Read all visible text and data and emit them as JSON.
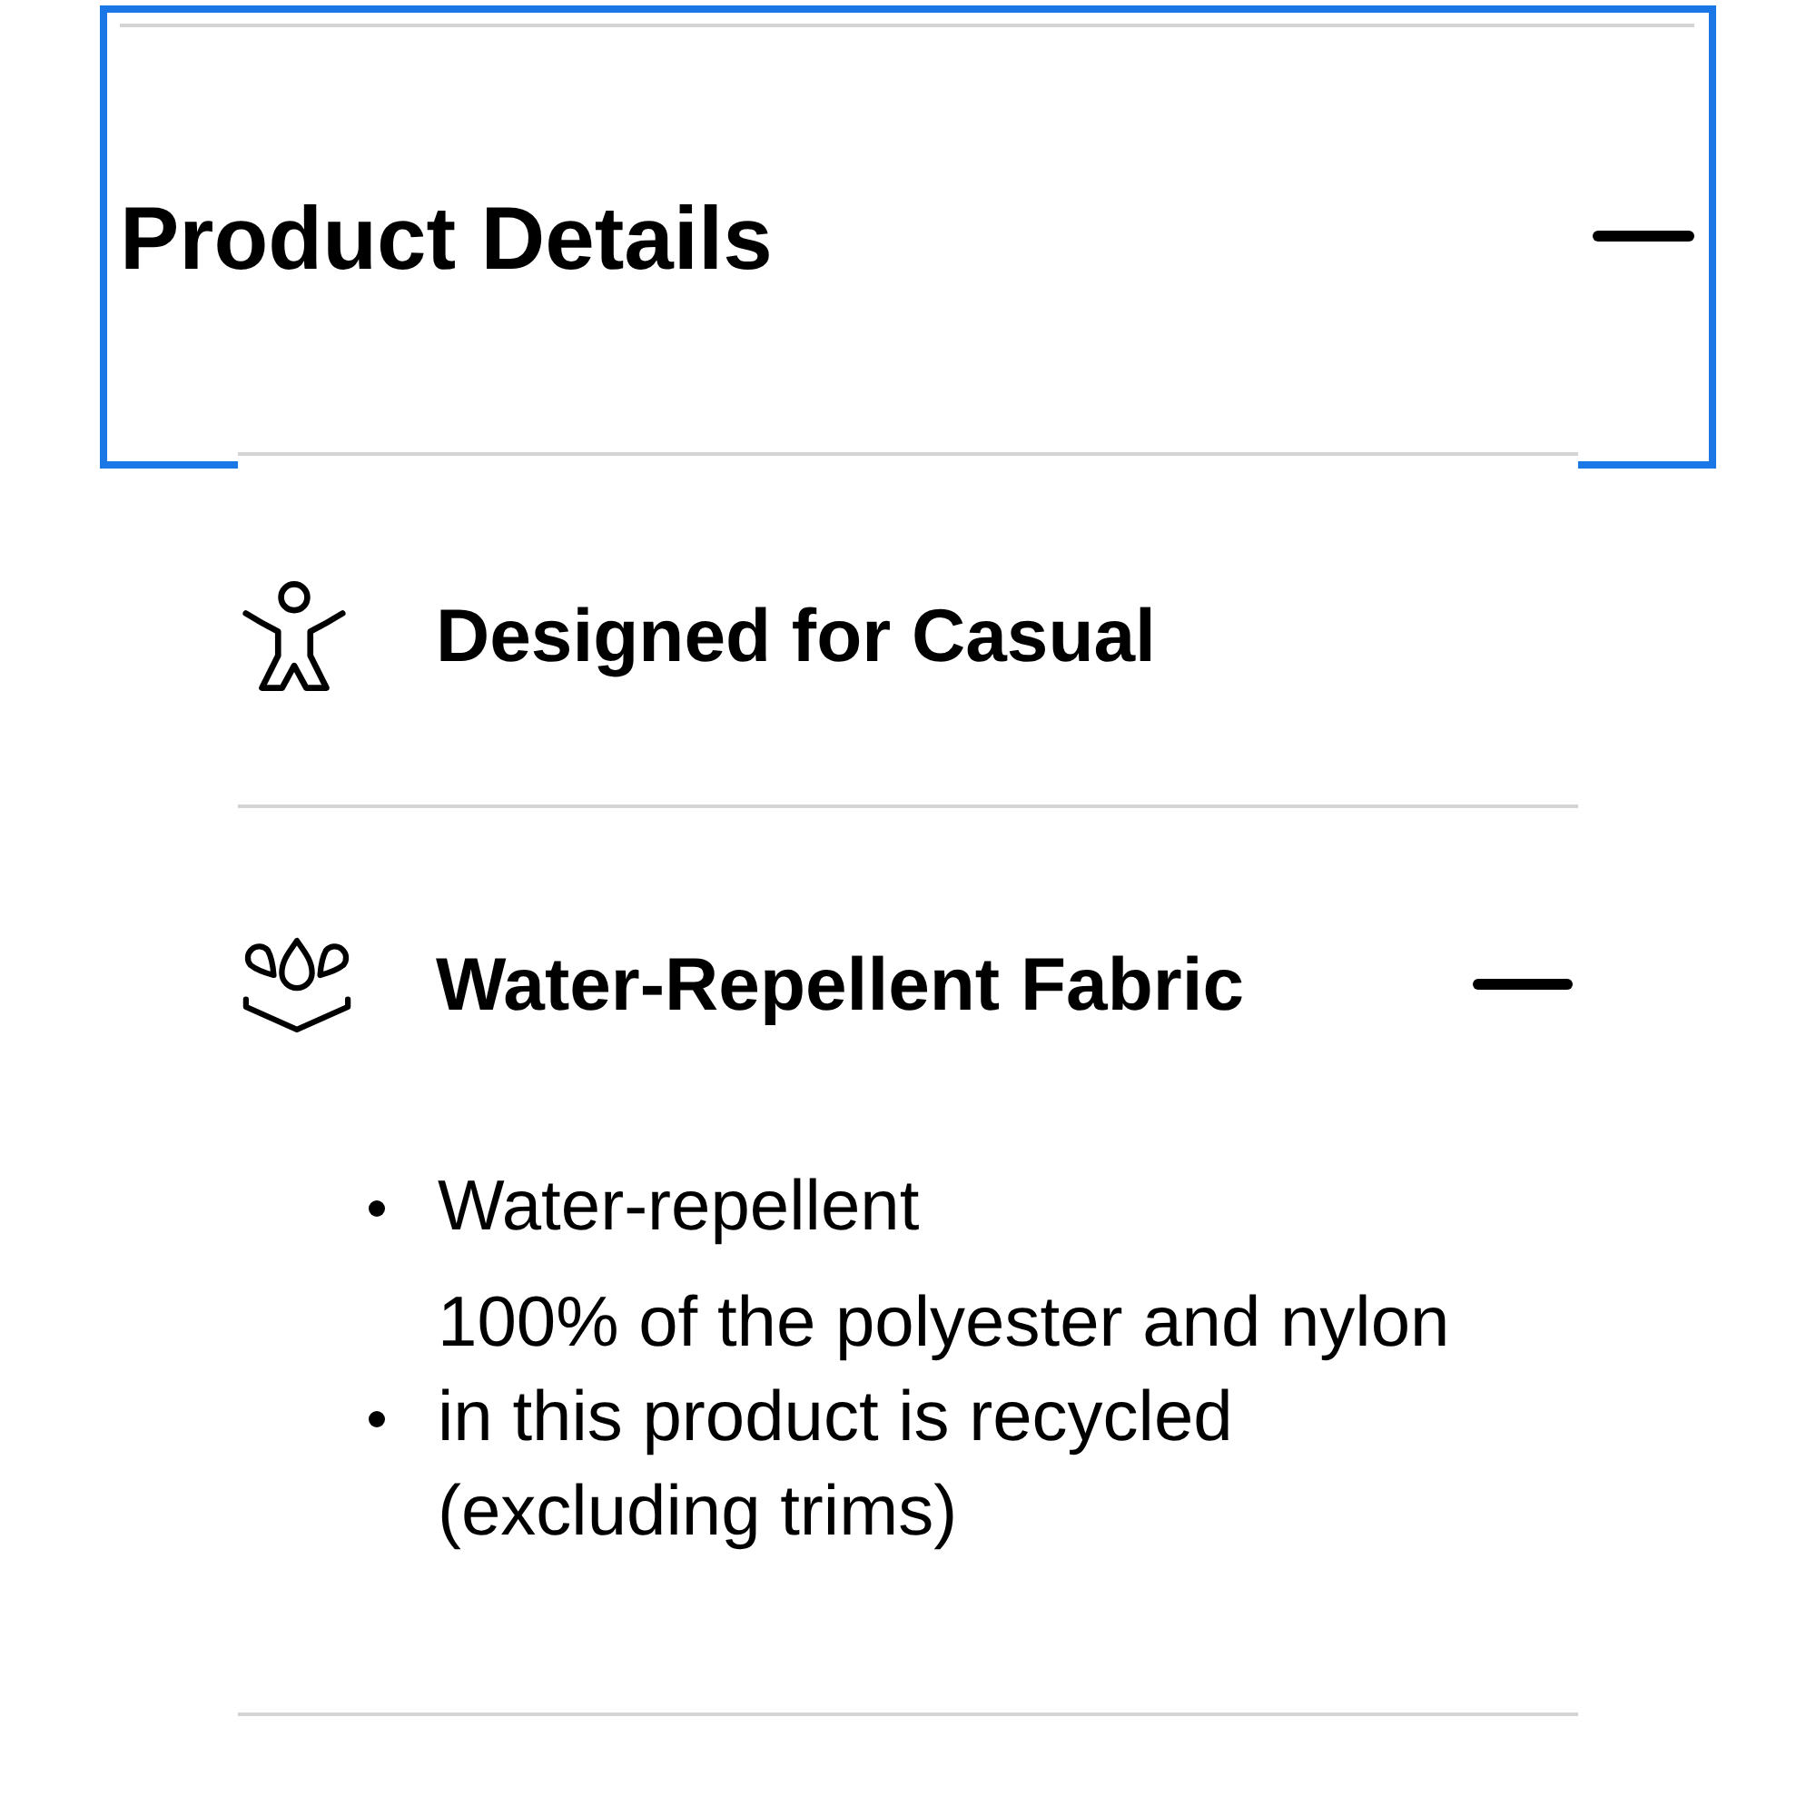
{
  "accordion": {
    "title": "Product Details",
    "focused": true,
    "expanded": true,
    "items": [
      {
        "kind": "label",
        "title": "Designed for Casual"
      },
      {
        "kind": "accordion",
        "title": "Water-Repellent Fabric",
        "expanded": true,
        "bullets": [
          "Water-repellent",
          "100% of the polyester and nylon in this product is recycled (excluding trims)"
        ]
      }
    ]
  }
}
